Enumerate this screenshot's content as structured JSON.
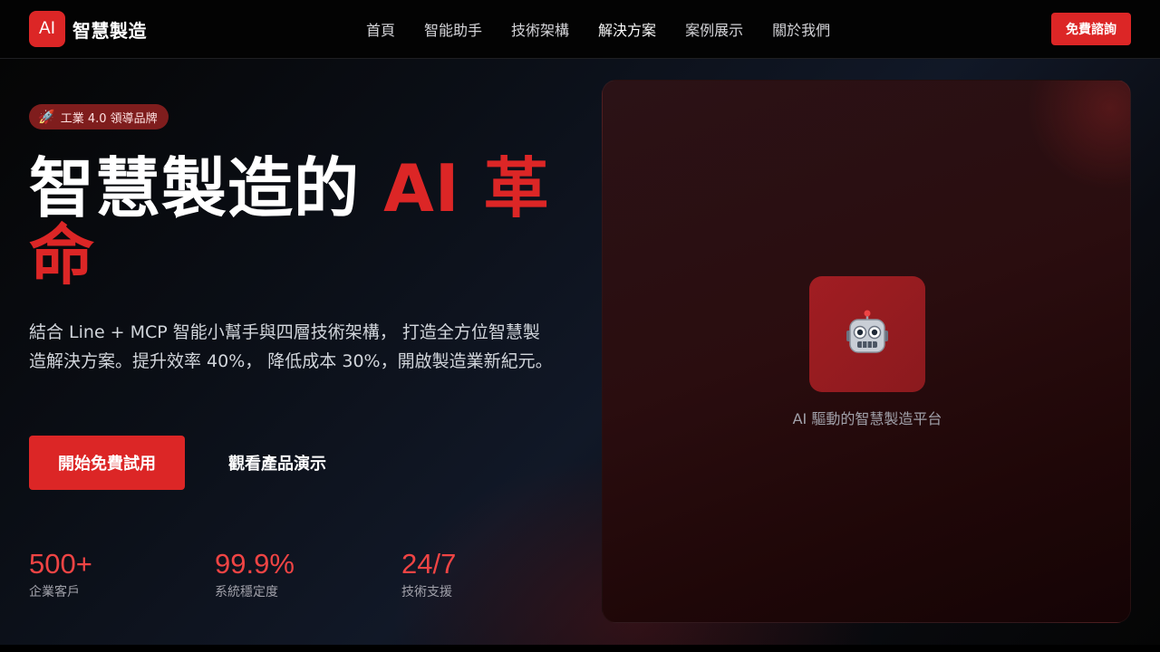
{
  "header": {
    "logo_mark": "AI",
    "logo_text": "智慧製造",
    "nav": [
      "首頁",
      "智能助手",
      "技術架構",
      "解決方案",
      "案例展示",
      "關於我們"
    ],
    "cta_label": "免費諮詢"
  },
  "hero": {
    "badge_icon": "rocket-icon",
    "badge_label": "工業 4.0 領導品牌",
    "headline_main": "智慧製造的 ",
    "headline_accent": "AI 革命",
    "description": "結合 Line + MCP 智能小幫手與四層技術架構， 打造全方位智慧製造解決方案。提升效率 40%， 降低成本 30%，開啟製造業新紀元。",
    "primary_button": "開始免費試用",
    "secondary_button": "觀看產品演示",
    "stats": [
      {
        "value": "500+",
        "label": "企業客戶"
      },
      {
        "value": "99.9%",
        "label": "系統穩定度"
      },
      {
        "value": "24/7",
        "label": "技術支援"
      }
    ]
  },
  "panel": {
    "icon": "robot-icon",
    "caption": "AI 驅動的智慧製造平台"
  },
  "colors": {
    "accent": "#dc2626",
    "stat_value": "#ef4444",
    "badge_bg": "#7f1d1d"
  }
}
